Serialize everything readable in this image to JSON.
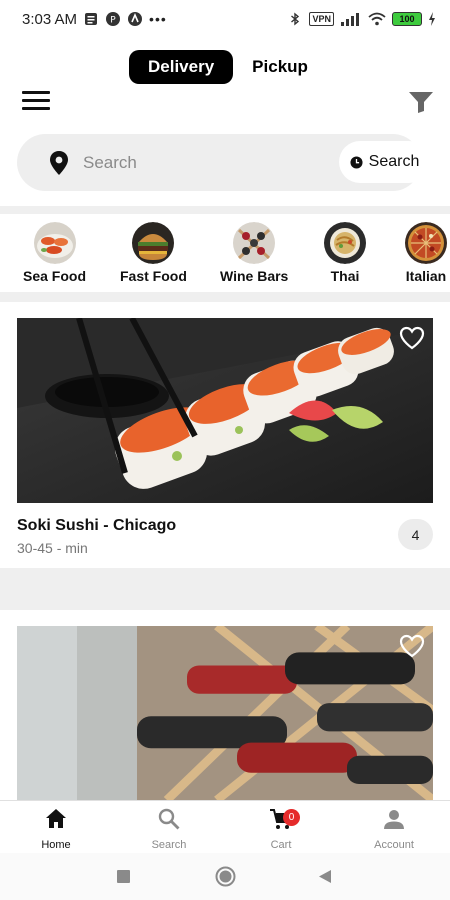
{
  "status_bar": {
    "time": "3:03 AM",
    "vpn": "VPN",
    "battery": "100"
  },
  "header": {
    "modes": [
      {
        "label": "Delivery",
        "active": true
      },
      {
        "label": "Pickup",
        "active": false
      }
    ],
    "menu_icon": "hamburger-menu-icon",
    "filter_icon": "filter-icon"
  },
  "search": {
    "placeholder": "Search",
    "button_label": "Search",
    "location_icon": "map-pin-icon",
    "schedule_icon": "clock-icon"
  },
  "categories": [
    {
      "label": "Sea Food",
      "icon": "sea-food-thumbnail"
    },
    {
      "label": "Fast Food",
      "icon": "fast-food-thumbnail"
    },
    {
      "label": "Wine Bars",
      "icon": "wine-bars-thumbnail"
    },
    {
      "label": "Thai",
      "icon": "thai-thumbnail"
    },
    {
      "label": "Italian",
      "icon": "italian-thumbnail"
    }
  ],
  "restaurants": [
    {
      "name": "Soki Sushi - Chicago",
      "delivery_time": "30-45 - min",
      "rating": "4",
      "favorite": false
    },
    {
      "name": "",
      "delivery_time": "",
      "rating": "",
      "favorite": false
    }
  ],
  "bottom_nav": [
    {
      "label": "Home",
      "icon": "home-icon",
      "active": true
    },
    {
      "label": "Search",
      "icon": "search-icon",
      "active": false
    },
    {
      "label": "Cart",
      "icon": "cart-icon",
      "active": false,
      "badge": "0"
    },
    {
      "label": "Account",
      "icon": "account-icon",
      "active": false
    }
  ],
  "colors": {
    "accent": "#000000",
    "badge": "#e52b2b",
    "surface": "#eeeeee",
    "muted_text": "#8a8a8a"
  }
}
